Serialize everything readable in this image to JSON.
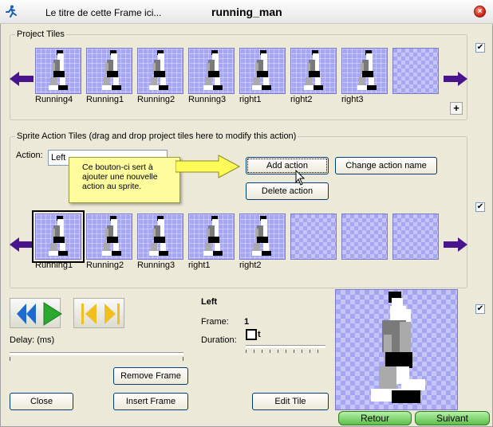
{
  "window": {
    "frame_title": "Le titre de cette Frame ici...",
    "title": "running_man",
    "close_glyph": "×"
  },
  "project_tiles": {
    "label": "Project Tiles",
    "tiles": [
      {
        "label": "Running4"
      },
      {
        "label": "Running1"
      },
      {
        "label": "Running2"
      },
      {
        "label": "Running3"
      },
      {
        "label": "right1"
      },
      {
        "label": "right2"
      },
      {
        "label": "right3"
      },
      {
        "label": ""
      }
    ],
    "add_glyph": "+",
    "checked_glyph": "✔"
  },
  "sprite_action": {
    "label": "Sprite Action Tiles (drag and drop project tiles here to modify this action)",
    "action_label": "Action:",
    "action_value": "Left",
    "add_action": "Add action",
    "change_action_name": "Change action name",
    "delete_action": "Delete action",
    "callout_text": "Ce bouton-ci sert à ajouter une nouvelle action au sprite.",
    "tiles": [
      {
        "label": "Running1"
      },
      {
        "label": "Running2"
      },
      {
        "label": "Running3"
      },
      {
        "label": "right1"
      },
      {
        "label": "right2"
      },
      {
        "label": ""
      },
      {
        "label": ""
      },
      {
        "label": ""
      }
    ],
    "checked_glyph": "✔"
  },
  "animation": {
    "delay_label": "Delay: (ms)",
    "remove_frame": "Remove Frame",
    "insert_frame": "Insert Frame",
    "close": "Close",
    "edit_tile": "Edit Tile",
    "action_name": "Left",
    "frame_label": "Frame:",
    "frame_value": "1",
    "duration_label": "Duration:",
    "duration_value": "t",
    "checked_glyph": "✔"
  },
  "navigation": {
    "back": "Retour",
    "next": "Suivant"
  },
  "colors": {
    "tile_bg": "#a6a6f2",
    "arrow": "#4a148c",
    "accent_yellow": "#f0c020",
    "accent_blue": "#1e6ad0",
    "accent_green": "#2aa830"
  }
}
